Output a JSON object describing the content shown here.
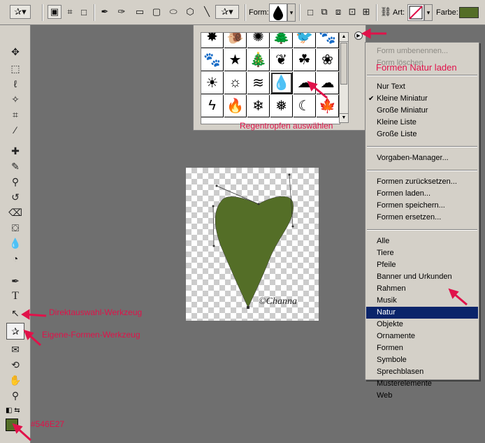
{
  "options_bar": {
    "form_label": "Form:",
    "art_label": "Art:",
    "farbe_label": "Farbe:",
    "color": "#546E27"
  },
  "shape_picker": {
    "shapes": [
      "star-burst-icon",
      "snail-icon",
      "splat-icon",
      "trees-icon",
      "crow-icon",
      "paw-print-icon",
      "paw-print-2-icon",
      "star-icon",
      "tree-icon",
      "leaf-fern-icon",
      "clover-icon",
      "butterfly-icon",
      "sun-icon",
      "sun-2-icon",
      "waves-icon",
      "raindrop-icon",
      "cloud-icon",
      "cloud-2-icon",
      "lightning-icon",
      "flame-icon",
      "snowflake-icon",
      "snowflake-2-icon",
      "moon-icon",
      "maple-leaf-icon"
    ]
  },
  "menu": {
    "items": [
      {
        "label": "Form umbenennen...",
        "disabled": true
      },
      {
        "label": "Form löschen",
        "disabled": true
      },
      {
        "label": "Nur Text"
      },
      {
        "label": "Kleine Miniatur",
        "checked": true
      },
      {
        "label": "Große Miniatur"
      },
      {
        "label": "Kleine Liste"
      },
      {
        "label": "Große Liste"
      },
      {
        "label": "Vorgaben-Manager..."
      },
      {
        "label": "Formen zurücksetzen..."
      },
      {
        "label": "Formen laden..."
      },
      {
        "label": "Formen speichern..."
      },
      {
        "label": "Formen ersetzen..."
      },
      {
        "label": "Alle"
      },
      {
        "label": "Tiere"
      },
      {
        "label": "Pfeile"
      },
      {
        "label": "Banner und Urkunden"
      },
      {
        "label": "Rahmen"
      },
      {
        "label": "Musik"
      },
      {
        "label": "Natur",
        "highlighted": true
      },
      {
        "label": "Objekte"
      },
      {
        "label": "Ornamente"
      },
      {
        "label": "Formen"
      },
      {
        "label": "Symbole"
      },
      {
        "label": "Sprechblasen"
      },
      {
        "label": "Musterelemente"
      },
      {
        "label": "Web"
      }
    ]
  },
  "annotations": {
    "formen_natur_laden": "Formen Natur laden",
    "regentropfen": "Regentropfen auswählen",
    "direktauswahl": "Direktauswahl-Werkzeug",
    "eigene_formen": "Eigene-Formen-Werkzeug",
    "color_code": "#546E27"
  },
  "canvas": {
    "watermark": "©Channa",
    "shape_color": "#546E27"
  }
}
